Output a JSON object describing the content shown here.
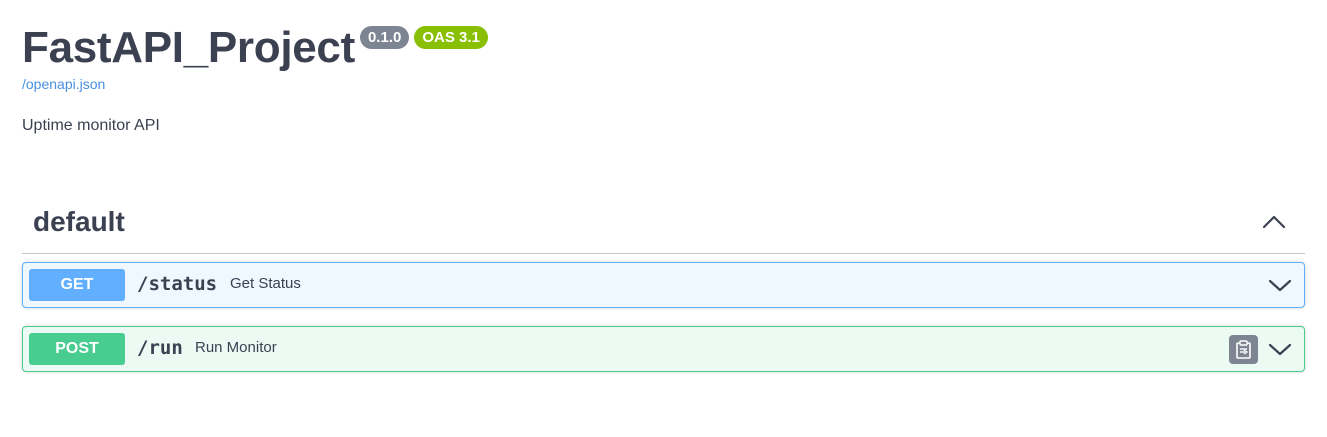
{
  "info": {
    "title": "FastAPI_Project",
    "version_badge": "0.1.0",
    "oas_badge": "OAS 3.1",
    "spec_link": "/openapi.json",
    "description": "Uptime monitor API"
  },
  "tags": [
    {
      "name": "default",
      "expanded": true,
      "toggle_icon": "chevron-up-icon",
      "operations": [
        {
          "method": "GET",
          "path": "/status",
          "summary": "Get Status",
          "color": "#61afe",
          "chevron_icon": "chevron-down-icon"
        },
        {
          "method": "POST",
          "path": "/run",
          "summary": "Run Monitor",
          "color": "#49cc90",
          "copy_icon": "clipboard-copy-icon",
          "chevron_icon": "chevron-down-icon"
        }
      ]
    }
  ],
  "colors": {
    "get": "#61affe",
    "post": "#49cc90",
    "version_badge": "#7d8492",
    "oas_badge": "#89bf04",
    "link": "#4990e2",
    "text": "#3b4151"
  }
}
